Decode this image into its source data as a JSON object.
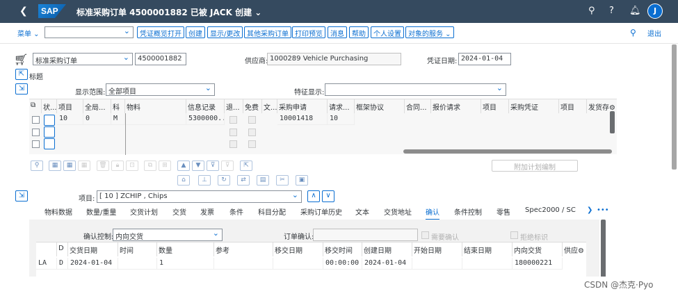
{
  "shell": {
    "logo": "SAP",
    "title": "标准采购订单 4500001882 已被 JACK 创建",
    "avatar": "J"
  },
  "toolbar": {
    "menu": "菜单",
    "buttons": [
      "凭证概览打开",
      "创建",
      "显示/更改",
      "其他采购订单",
      "打印预览",
      "消息",
      "帮助",
      "个人设置",
      "对象的服务"
    ],
    "exit": "退出"
  },
  "header": {
    "doc_type": "标准采购订单",
    "po_number": "4500001882",
    "vendor_label": "供应商:",
    "vendor": "1000289 Vehicle Purchasing",
    "doc_date_label": "凭证日期:",
    "doc_date": "2024-01-04",
    "header_label": "标题"
  },
  "overview": {
    "scope_label": "显示范围:",
    "scope_value": "全部项目",
    "feature_label": "特征显示:",
    "feature_value": "",
    "columns": [
      "状...",
      "项目",
      "全局...",
      "科",
      "物料",
      "信息记录",
      "退...",
      "免费",
      "文...",
      "采购申请",
      "请求...",
      "框架协议",
      "合同...",
      "报价请求",
      "项目",
      "采购凭证",
      "项目",
      "发货存"
    ],
    "rows": [
      {
        "item": "10",
        "global": "0",
        "acct": "M",
        "info": "5300000...",
        "pr": "10001418",
        "pr_item": "10"
      }
    ],
    "attach_plan": "附加计划编制"
  },
  "item_detail": {
    "item_label": "项目:",
    "item_value": "[ 10 ] ZCHIP , Chips",
    "tabs": [
      "物料数据",
      "数量/重量",
      "交货计划",
      "交货",
      "发票",
      "条件",
      "科目分配",
      "采购订单历史",
      "文本",
      "交货地址",
      "确认",
      "条件控制",
      "零售",
      "Spec2000 / SC"
    ],
    "active_tab": "确认",
    "conf_control_label": "确认控制:",
    "conf_control_value": "内向交货",
    "order_ack_label": "订单确认:",
    "order_ack_value": "",
    "need_ack": "需要确认",
    "reject_flag": "拒绝标识",
    "columns": [
      "D",
      "交货日期",
      "时间",
      "数量",
      "参考",
      "移交日期",
      "移交时间",
      "创建日期",
      "开始日期",
      "结束日期",
      "内向交货",
      "供应"
    ],
    "rows": [
      {
        "c": "LA",
        "d": "D",
        "date": "2024-01-04",
        "time": "",
        "qty": "1",
        "ref": "",
        "handover_date": "",
        "handover_time": "00:00:00",
        "created": "2024-01-04",
        "start": "",
        "end": "",
        "inbound": "180000221"
      }
    ]
  },
  "watermark": "CSDN @杰克·Pyo"
}
